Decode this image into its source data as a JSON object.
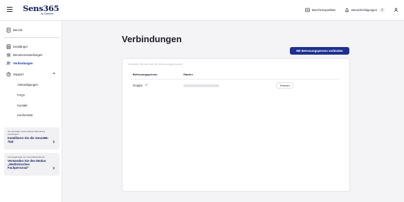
{
  "brand": {
    "name": "Sens365",
    "sub": "by Carefree"
  },
  "header": {
    "export_label": "Bericht-Exportliste",
    "notifications_label": "Benachrichtigungen",
    "notifications_count": "1"
  },
  "sidebar": {
    "items": [
      {
        "label": "Bericht",
        "icon": "report-icon"
      },
      {
        "label": "Empfänger",
        "icon": "recipient-icon"
      },
      {
        "label": "Benutzereinstellungen",
        "icon": "settings-icon"
      },
      {
        "label": "Verbindungen",
        "icon": "connections-icon",
        "active": true
      },
      {
        "label": "Support",
        "icon": "help-icon"
      }
    ],
    "support_sub": [
      "Ankündigungen",
      "FAQs",
      "Kontakt",
      "Konformität"
    ],
    "cards": [
      {
        "small": "Um die Daten eines anderen Benutzers anzuzeigen:",
        "big": "Installieren Sie die Sens365-App"
      },
      {
        "small": "Für Angehörige der Gesundheitsberufe:",
        "big": "Verwenden Sie den Modus „Medizinisches Fachpersonal“"
      }
    ]
  },
  "main": {
    "title": "Verbindungen",
    "connect_button": "Mit Betreuungsperson verbinden",
    "hint": "Verwalten Sie die Liste der Betreuungspersonen",
    "columns": [
      "Betreuungsperson",
      "Starten"
    ],
    "rows": [
      {
        "name": "Gruppe",
        "action": "Trennen"
      }
    ]
  },
  "colors": {
    "accent": "#1d2f8f",
    "brand": "#0f1d5c",
    "active_nav": "#143896"
  }
}
